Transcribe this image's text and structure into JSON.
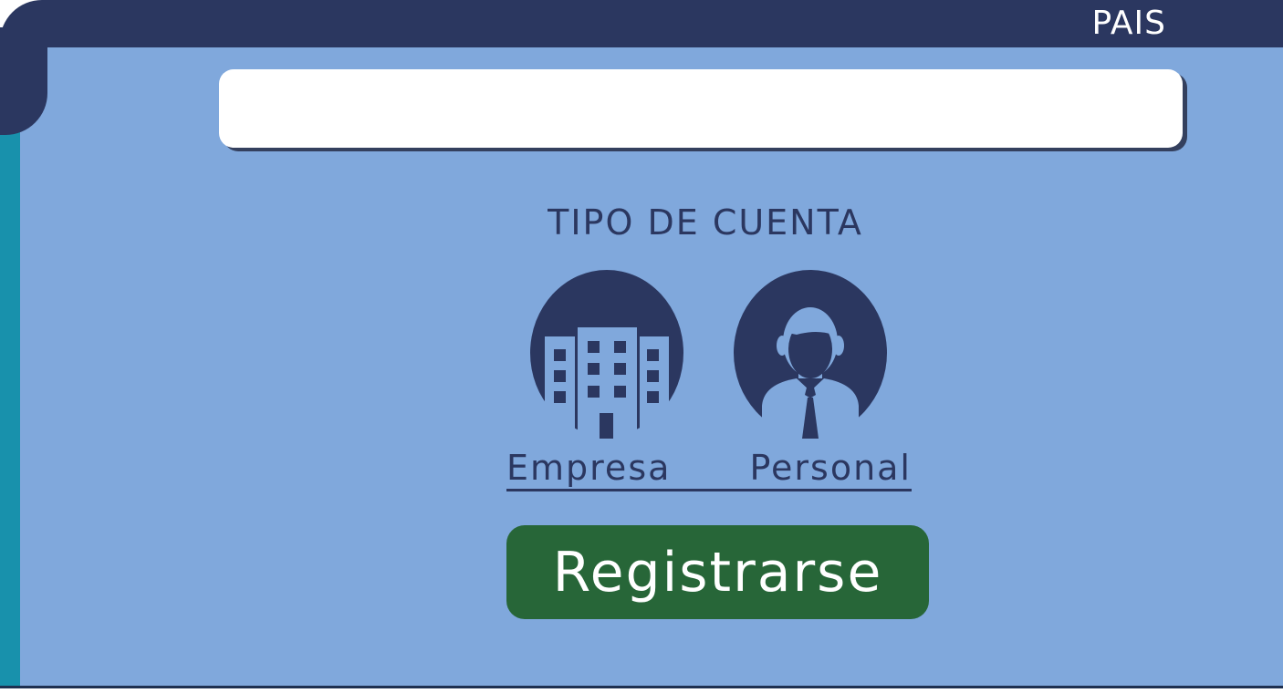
{
  "header": {
    "country_label": "PAIS"
  },
  "country_input": {
    "value": "",
    "placeholder": ""
  },
  "account_type": {
    "heading": "TIPO DE CUENTA",
    "options": [
      {
        "label": "Empresa",
        "icon": "building-icon"
      },
      {
        "label": "Personal",
        "icon": "person-icon"
      }
    ]
  },
  "register_button": {
    "label": "Registrarse"
  },
  "colors": {
    "header_bar": "#2b3760",
    "panel_background": "#80a8dc",
    "side_accent": "#1891ac",
    "input_background": "#ffffff",
    "heading_text": "#2b3760",
    "register_button": "#276638",
    "register_text": "#ffffff"
  }
}
